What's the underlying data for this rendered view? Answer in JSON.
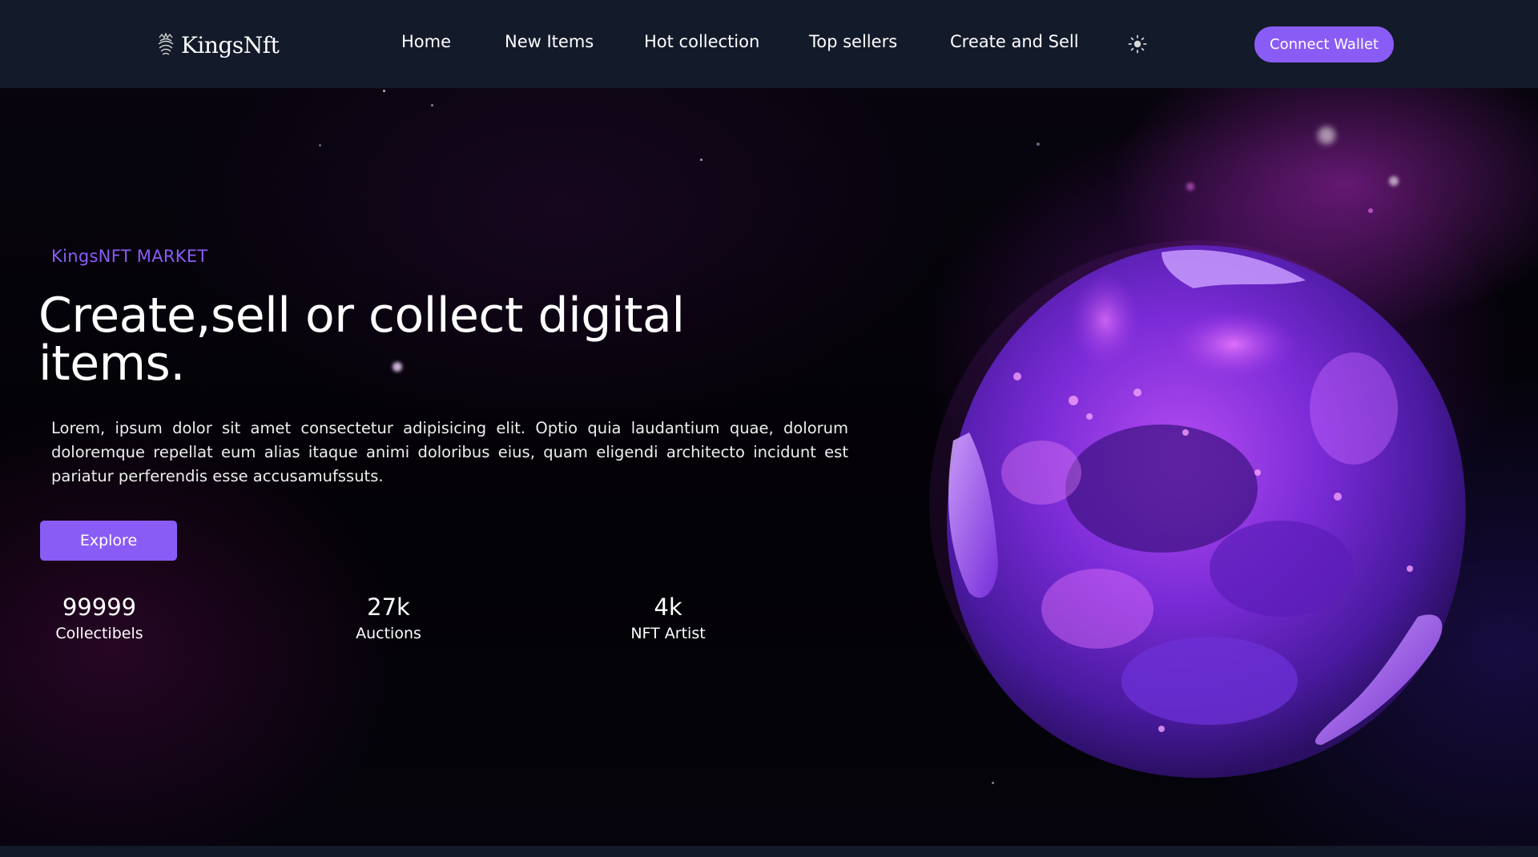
{
  "brand": {
    "name": "KingsNft",
    "logo_icon": "crown-fingerprint-icon"
  },
  "nav": {
    "links": [
      "Home",
      "New Items",
      "Hot collection",
      "Top sellers",
      "Create and Sell"
    ],
    "theme_icon": "sun-icon",
    "connect_label": "Connect Wallet"
  },
  "hero": {
    "eyebrow": "KingsNFT MARKET",
    "headline_line1": "Create,sell or collect digital",
    "headline_line2": "items.",
    "lead": "Lorem, ipsum dolor sit amet consectetur adipisicing elit. Optio quia laudantium quae, dolorum doloremque repellat eum alias itaque animi doloribus eius, quam eligendi architecto incidunt est pariatur perferendis esse accusamufssuts.",
    "explore_label": "Explore",
    "stats": [
      {
        "value": "99999",
        "label": "Collectibels"
      },
      {
        "value": "27k",
        "label": "Auctions"
      },
      {
        "value": "4k",
        "label": "NFT Artist"
      }
    ],
    "image": "purple-nft-sphere"
  },
  "colors": {
    "accent": "#8a5cf6",
    "nav_bg": "#131a2a",
    "hero_bg": "#05030a"
  }
}
